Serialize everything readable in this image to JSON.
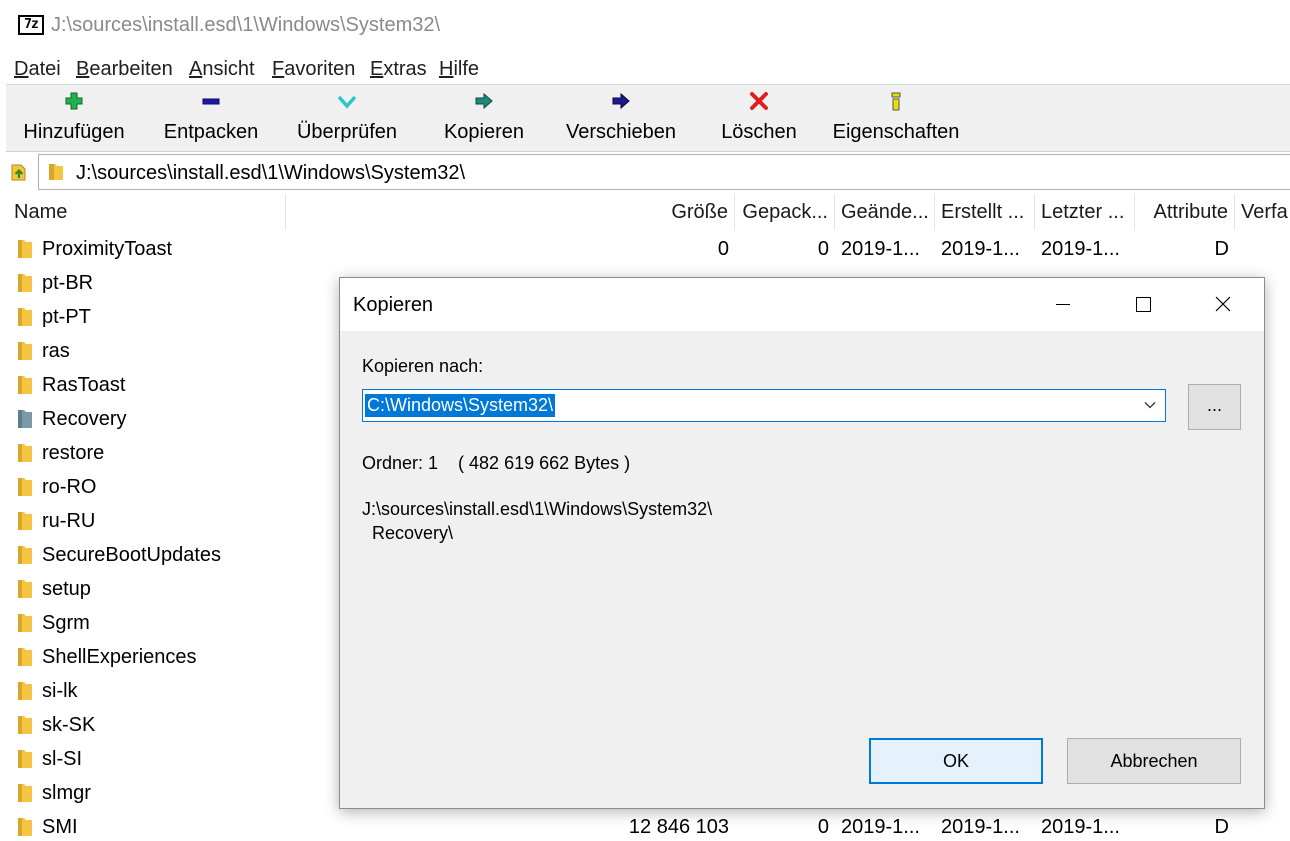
{
  "window": {
    "logo_text": "7z",
    "title": "J:\\sources\\install.esd\\1\\Windows\\System32\\"
  },
  "menu": [
    {
      "accel": "D",
      "rest": "atei"
    },
    {
      "accel": "B",
      "rest": "earbeiten"
    },
    {
      "accel": "A",
      "rest": "nsicht"
    },
    {
      "accel": "F",
      "rest": "avoriten"
    },
    {
      "accel": "E",
      "rest": "xtras"
    },
    {
      "accel": "H",
      "rest": "ilfe"
    }
  ],
  "toolbar": [
    {
      "label": "Hinzufügen",
      "icon": "plus-icon",
      "color": "#22b14c"
    },
    {
      "label": "Entpacken",
      "icon": "minus-icon",
      "color": "#1a1aa6"
    },
    {
      "label": "Überprüfen",
      "icon": "check-icon",
      "color": "#2cc6c6"
    },
    {
      "label": "Kopieren",
      "icon": "copy-arrow-icon",
      "color": "#1d8a7c"
    },
    {
      "label": "Verschieben",
      "icon": "move-arrow-icon",
      "color": "#1a1a8c"
    },
    {
      "label": "Löschen",
      "icon": "delete-x-icon",
      "color": "#e02020"
    },
    {
      "label": "Eigenschaften",
      "icon": "info-icon",
      "color": "#e8e000"
    }
  ],
  "address": {
    "value": "J:\\sources\\install.esd\\1\\Windows\\System32\\"
  },
  "columns": [
    "Name",
    "Größe",
    "Gepack...",
    "Geände...",
    "Erstellt ...",
    "Letzter ...",
    "Attribute",
    "Verfa"
  ],
  "rows": [
    {
      "name": "ProximityToast",
      "icon": "folder-icon",
      "size": "0",
      "packed": "0",
      "modified": "2019-1...",
      "created": "2019-1...",
      "accessed": "2019-1...",
      "attr": "D"
    },
    {
      "name": "pt-BR",
      "icon": "folder-icon",
      "size": "",
      "packed": "",
      "modified": "",
      "created": "",
      "accessed": "",
      "attr": ""
    },
    {
      "name": "pt-PT",
      "icon": "folder-icon",
      "size": "",
      "packed": "",
      "modified": "",
      "created": "",
      "accessed": "",
      "attr": ""
    },
    {
      "name": "ras",
      "icon": "folder-icon",
      "size": "",
      "packed": "",
      "modified": "",
      "created": "",
      "accessed": "",
      "attr": ""
    },
    {
      "name": "RasToast",
      "icon": "folder-icon",
      "size": "",
      "packed": "",
      "modified": "",
      "created": "",
      "accessed": "",
      "attr": ""
    },
    {
      "name": "Recovery",
      "icon": "folder-selected-icon",
      "size": "",
      "packed": "",
      "modified": "",
      "created": "",
      "accessed": "",
      "attr": ""
    },
    {
      "name": "restore",
      "icon": "folder-icon",
      "size": "",
      "packed": "",
      "modified": "",
      "created": "",
      "accessed": "",
      "attr": ""
    },
    {
      "name": "ro-RO",
      "icon": "folder-icon",
      "size": "",
      "packed": "",
      "modified": "",
      "created": "",
      "accessed": "",
      "attr": ""
    },
    {
      "name": "ru-RU",
      "icon": "folder-icon",
      "size": "",
      "packed": "",
      "modified": "",
      "created": "",
      "accessed": "",
      "attr": ""
    },
    {
      "name": "SecureBootUpdates",
      "icon": "folder-icon",
      "size": "",
      "packed": "",
      "modified": "",
      "created": "",
      "accessed": "",
      "attr": ""
    },
    {
      "name": "setup",
      "icon": "folder-icon",
      "size": "",
      "packed": "",
      "modified": "",
      "created": "",
      "accessed": "",
      "attr": ""
    },
    {
      "name": "Sgrm",
      "icon": "folder-icon",
      "size": "",
      "packed": "",
      "modified": "",
      "created": "",
      "accessed": "",
      "attr": ""
    },
    {
      "name": "ShellExperiences",
      "icon": "folder-icon",
      "size": "",
      "packed": "",
      "modified": "",
      "created": "",
      "accessed": "",
      "attr": ""
    },
    {
      "name": "si-lk",
      "icon": "folder-icon",
      "size": "",
      "packed": "",
      "modified": "",
      "created": "",
      "accessed": "",
      "attr": ""
    },
    {
      "name": "sk-SK",
      "icon": "folder-icon",
      "size": "",
      "packed": "",
      "modified": "",
      "created": "",
      "accessed": "",
      "attr": ""
    },
    {
      "name": "sl-SI",
      "icon": "folder-icon",
      "size": "",
      "packed": "",
      "modified": "",
      "created": "",
      "accessed": "",
      "attr": ""
    },
    {
      "name": "slmgr",
      "icon": "folder-icon",
      "size": "",
      "packed": "",
      "modified": "",
      "created": "",
      "accessed": "",
      "attr": ""
    },
    {
      "name": "SMI",
      "icon": "folder-icon",
      "size": "12 846 103",
      "packed": "0",
      "modified": "2019-1...",
      "created": "2019-1...",
      "accessed": "2019-1...",
      "attr": "D"
    }
  ],
  "dialog": {
    "title": "Kopieren",
    "dest_label": "Kopieren nach:",
    "dest_value": "C:\\Windows\\System32\\",
    "browse_label": "...",
    "info": "Ordner: 1    ( 482 619 662 Bytes )",
    "source_path": "J:\\sources\\install.esd\\1\\Windows\\System32\\",
    "source_item": "Recovery\\",
    "ok_label": "OK",
    "cancel_label": "Abbrechen"
  },
  "colors": {
    "accent": "#0078d7",
    "folder": "#f4c542",
    "folder_selected": "#7a9aa6"
  }
}
